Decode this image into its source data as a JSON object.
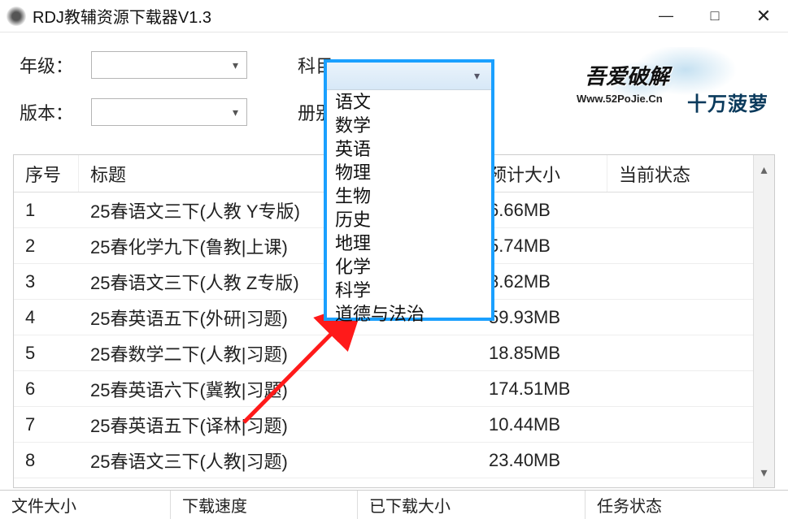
{
  "window": {
    "title": "RDJ教辅资源下载器V1.3"
  },
  "filters": {
    "grade_label": "年级：",
    "subject_label": "科目：",
    "version_label": "版本：",
    "volume_label": "册别：",
    "subject_options": [
      "语文",
      "数学",
      "英语",
      "物理",
      "生物",
      "历史",
      "地理",
      "化学",
      "科学",
      "道德与法治"
    ]
  },
  "brand": {
    "name": "吾爱破解",
    "url": "Www.52PoJie.Cn",
    "author": "十万菠萝"
  },
  "table": {
    "headers": {
      "idx": "序号",
      "title": "标题",
      "size": "预计大小",
      "status": "当前状态"
    },
    "rows": [
      {
        "idx": "1",
        "title": "25春语文三下(人教 Y专版)",
        "size": "6.66MB",
        "status": ""
      },
      {
        "idx": "2",
        "title": "25春化学九下(鲁教|上课)",
        "size": "5.74MB",
        "status": ""
      },
      {
        "idx": "3",
        "title": "25春语文三下(人教 Z专版)",
        "size": "8.62MB",
        "status": ""
      },
      {
        "idx": "4",
        "title": "25春英语五下(外研|习题)",
        "size": "59.93MB",
        "status": ""
      },
      {
        "idx": "5",
        "title": "25春数学二下(人教|习题)",
        "size": "18.85MB",
        "status": ""
      },
      {
        "idx": "6",
        "title": "25春英语六下(冀教|习题)",
        "size": "174.51MB",
        "status": ""
      },
      {
        "idx": "7",
        "title": "25春英语五下(译林|习题)",
        "size": "10.44MB",
        "status": ""
      },
      {
        "idx": "8",
        "title": "25春语文三下(人教|习题)",
        "size": "23.40MB",
        "status": ""
      }
    ]
  },
  "statusbar": {
    "filesize": "文件大小",
    "speed": "下载速度",
    "downloaded": "已下载大小",
    "taskstatus": "任务状态"
  }
}
